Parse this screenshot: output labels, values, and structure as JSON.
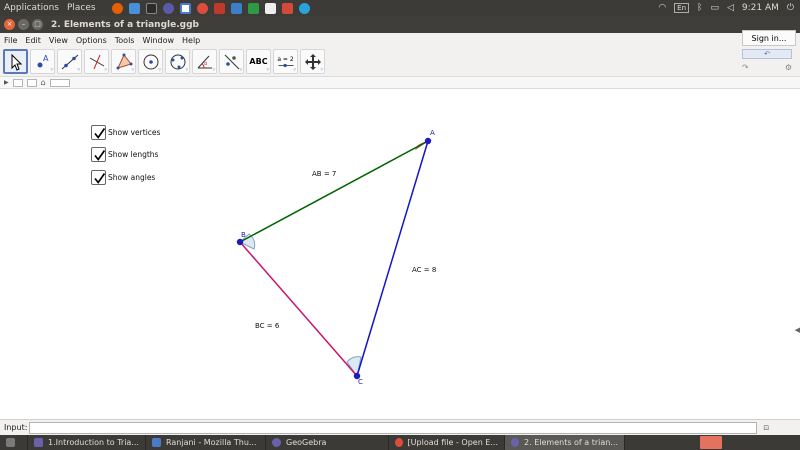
{
  "top_panel": {
    "applications_label": "Applications",
    "places_label": "Places",
    "language": "En",
    "time": "9:21 AM"
  },
  "window": {
    "title": "2. Elements of a triangle.ggb"
  },
  "menu": {
    "items": [
      "File",
      "Edit",
      "View",
      "Options",
      "Tools",
      "Window",
      "Help"
    ],
    "signin_label": "Sign in..."
  },
  "toolbar": {
    "tools": [
      "move",
      "point",
      "line",
      "perpendicular-line",
      "polygon",
      "circle-center-point",
      "circle-three-points",
      "angle",
      "reflect-about-line",
      "text",
      "slider",
      "move-graphics-view"
    ],
    "text_tool_label": "ABC",
    "slider_tool_label": "a = 2"
  },
  "checkboxes": [
    {
      "label": "Show vertices",
      "checked": true
    },
    {
      "label": "Show lengths",
      "checked": true
    },
    {
      "label": "Show angles",
      "checked": true
    }
  ],
  "triangle": {
    "vertices": [
      {
        "name": "A",
        "color": "#1b1bbf"
      },
      {
        "name": "B",
        "color": "#1b1bbf"
      },
      {
        "name": "C",
        "color": "#1b1bbf"
      }
    ],
    "sides": [
      {
        "label": "AB = 7",
        "color": "#006400"
      },
      {
        "label": "AC = 8",
        "color": "#1414c8"
      },
      {
        "label": "BC = 6",
        "color": "#c8146e"
      }
    ],
    "angle_color": "#7da4c8",
    "angle_A_color": "#c86464"
  },
  "input_bar": {
    "label": "Input:",
    "value": ""
  },
  "taskbar": {
    "items": [
      {
        "label": "1.Introduction to Tria...",
        "active": false
      },
      {
        "label": "Ranjani - Mozilla Thu...",
        "active": false
      },
      {
        "label": "GeoGebra",
        "active": false
      },
      {
        "label": "[Upload file - Open E...",
        "active": false
      },
      {
        "label": "2. Elements of a trian...",
        "active": true
      }
    ]
  }
}
